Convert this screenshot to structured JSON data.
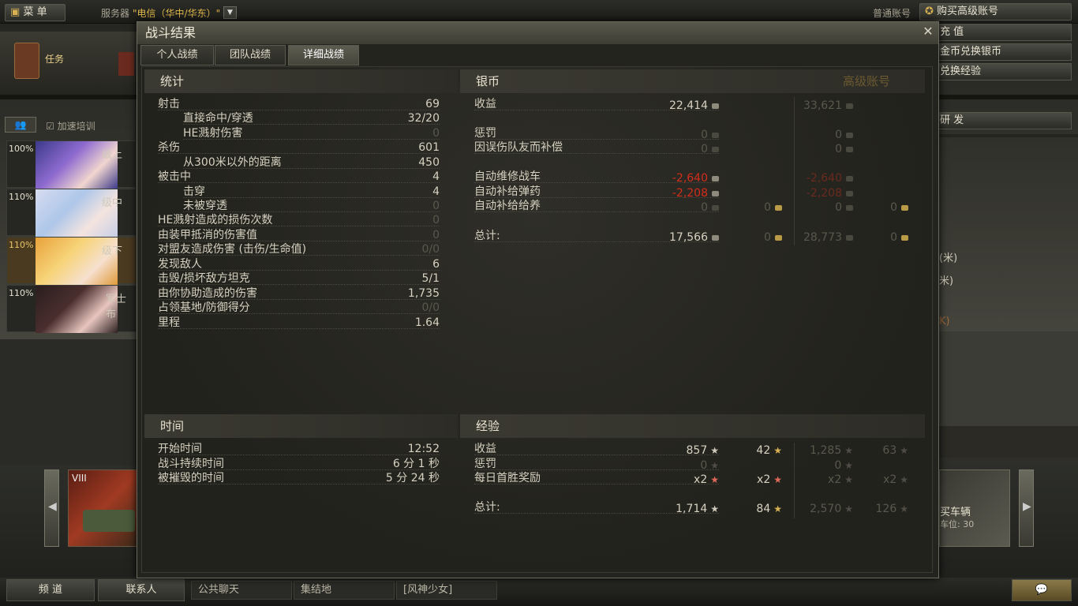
{
  "topbar": {
    "menu": "菜 单",
    "server_label": "服务器",
    "server_value": "\"电信（华中/华东）\"",
    "account_type": "普通账号",
    "buy_premium": "购买高级账号"
  },
  "left": {
    "task": "任务",
    "crew_label": "加速培训"
  },
  "crew": [
    {
      "pct": "100%",
      "rank": "级上"
    },
    {
      "pct": "110%",
      "rank": "级中"
    },
    {
      "pct": "110%",
      "rank": "级下"
    },
    {
      "pct": "110%",
      "rank": "军士 布"
    }
  ],
  "right": {
    "recharge": "充 值",
    "gold_silver": "金币兑换银币",
    "exchange_exp": "兑换经验",
    "research": "研 发",
    "side1": "(米)",
    "side2": "米)",
    "side3": "K)",
    "buy_vehicle": "买车辆",
    "slots": "车位: 30"
  },
  "tank_tier": "VIII",
  "bottom": {
    "channel": "频 道",
    "contacts": "联系人",
    "chat_tabs": [
      "公共聊天",
      "集结地",
      "[风神少女]"
    ]
  },
  "window": {
    "title": "战斗结果",
    "tabs": [
      "个人战绩",
      "团队战绩",
      "详细战绩"
    ],
    "stats": {
      "header": "统计",
      "rows": [
        {
          "label": "射击",
          "value": "69",
          "indent": false,
          "dim": false
        },
        {
          "label": "直接命中/穿透",
          "value": "32/20",
          "indent": true,
          "dim": false
        },
        {
          "label": "HE溅射伤害",
          "value": "0",
          "indent": true,
          "dim": true
        },
        {
          "label": "杀伤",
          "value": "601",
          "indent": false,
          "dim": false
        },
        {
          "label": "从300米以外的距离",
          "value": "450",
          "indent": true,
          "dim": false
        },
        {
          "label": "被击中",
          "value": "4",
          "indent": false,
          "dim": false
        },
        {
          "label": "击穿",
          "value": "4",
          "indent": true,
          "dim": false
        },
        {
          "label": "未被穿透",
          "value": "0",
          "indent": true,
          "dim": true
        },
        {
          "label": "HE溅射造成的损伤次数",
          "value": "0",
          "indent": false,
          "dim": true
        },
        {
          "label": "由装甲抵消的伤害值",
          "value": "0",
          "indent": false,
          "dim": true
        },
        {
          "label": "对盟友造成伤害 (击伤/生命值)",
          "value": "0/0",
          "indent": false,
          "dim": true
        },
        {
          "label": "发现敌人",
          "value": "6",
          "indent": false,
          "dim": false
        },
        {
          "label": "击毁/损坏敌方坦克",
          "value": "5/1",
          "indent": false,
          "dim": false
        },
        {
          "label": "由你协助造成的伤害",
          "value": "1,735",
          "indent": false,
          "dim": false
        },
        {
          "label": "占领基地/防御得分",
          "value": "0/0",
          "indent": false,
          "dim": true
        },
        {
          "label": "里程",
          "value": "1.64",
          "indent": false,
          "dim": false
        }
      ]
    },
    "silver": {
      "header": "银币",
      "premium_header": "高级账号",
      "rows": [
        {
          "label": "收益",
          "v1": "22,414",
          "v2": "",
          "p1": "33,621",
          "p2": "",
          "style": "normal"
        },
        {
          "label": "惩罚",
          "v1": "0",
          "v2": "",
          "p1": "0",
          "p2": "",
          "style": "dim"
        },
        {
          "label": "因误伤队友而补偿",
          "v1": "0",
          "v2": "",
          "p1": "0",
          "p2": "",
          "style": "dim"
        },
        {
          "label": "自动维修战车",
          "v1": "-2,640",
          "v2": "",
          "p1": "-2,640",
          "p2": "",
          "style": "red"
        },
        {
          "label": "自动补给弹药",
          "v1": "-2,208",
          "v2": "",
          "p1": "-2,208",
          "p2": "",
          "style": "red"
        },
        {
          "label": "自动补给给养",
          "v1": "0",
          "v2": "0",
          "p1": "0",
          "p2": "0",
          "style": "dim"
        },
        {
          "label": "总计:",
          "v1": "17,566",
          "v2": "0",
          "p1": "28,773",
          "p2": "0",
          "style": "total"
        }
      ]
    },
    "time": {
      "header": "时间",
      "rows": [
        {
          "label": "开始时间",
          "value": "12:52"
        },
        {
          "label": "战斗持续时间",
          "value": "6 分 1 秒"
        },
        {
          "label": "被摧毁的时间",
          "value": "5 分 24 秒"
        }
      ]
    },
    "exp": {
      "header": "经验",
      "rows": [
        {
          "label": "收益",
          "v1": "857",
          "v2": "42",
          "p1": "1,285",
          "p2": "63",
          "style": "normal"
        },
        {
          "label": "惩罚",
          "v1": "0",
          "v2": "",
          "p1": "0",
          "p2": "",
          "style": "dim"
        },
        {
          "label": "每日首胜奖励",
          "v1": "x2",
          "v2": "x2",
          "p1": "x2",
          "p2": "x2",
          "style": "bonus"
        },
        {
          "label": "总计:",
          "v1": "1,714",
          "v2": "84",
          "p1": "2,570",
          "p2": "126",
          "style": "total"
        }
      ]
    }
  }
}
